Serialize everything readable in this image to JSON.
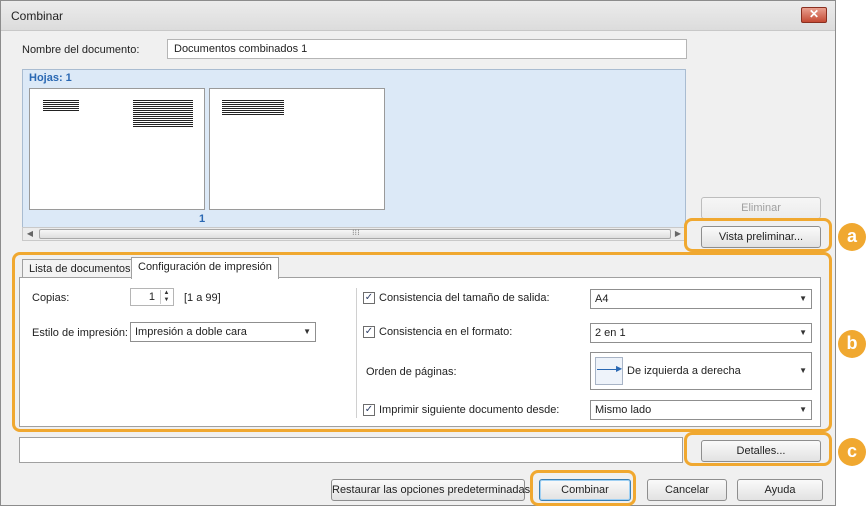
{
  "window": {
    "title": "Combinar",
    "close_label": "✕"
  },
  "document_name": {
    "label": "Nombre del documento:",
    "value": "Documentos combinados 1"
  },
  "preview": {
    "sheets_label": "Hojas: 1",
    "page_number": "1",
    "scroll_grip": "⁝⁝⁝"
  },
  "side_buttons": {
    "delete": "Eliminar",
    "preview": "Vista preliminar..."
  },
  "tabs": {
    "documents": "Lista de documentos",
    "print_settings": "Configuración de impresión"
  },
  "print_settings": {
    "copies_label": "Copias:",
    "copies_value": "1",
    "copies_range": "[1 a 99]",
    "style_label": "Estilo de impresión:",
    "style_value": "Impresión a doble cara",
    "size_consistency_label": "Consistencia del tamaño de salida:",
    "size_consistency_value": "A4",
    "format_consistency_label": "Consistencia en el formato:",
    "format_consistency_value": "2 en 1",
    "page_order_label": "Orden de páginas:",
    "page_order_value": "De izquierda a derecha",
    "next_doc_label": "Imprimir siguiente documento desde:",
    "next_doc_value": "Mismo lado"
  },
  "details_button": "Detalles...",
  "footer": {
    "restore": "Restaurar las opciones predeterminadas",
    "combine": "Combinar",
    "cancel": "Cancelar",
    "help": "Ayuda"
  },
  "markers": {
    "a": "a",
    "b": "b",
    "c": "c"
  },
  "colors": {
    "highlight": "#f0a830",
    "preview_bg": "#dce9f7",
    "sheets_label": "#2a68b3"
  }
}
